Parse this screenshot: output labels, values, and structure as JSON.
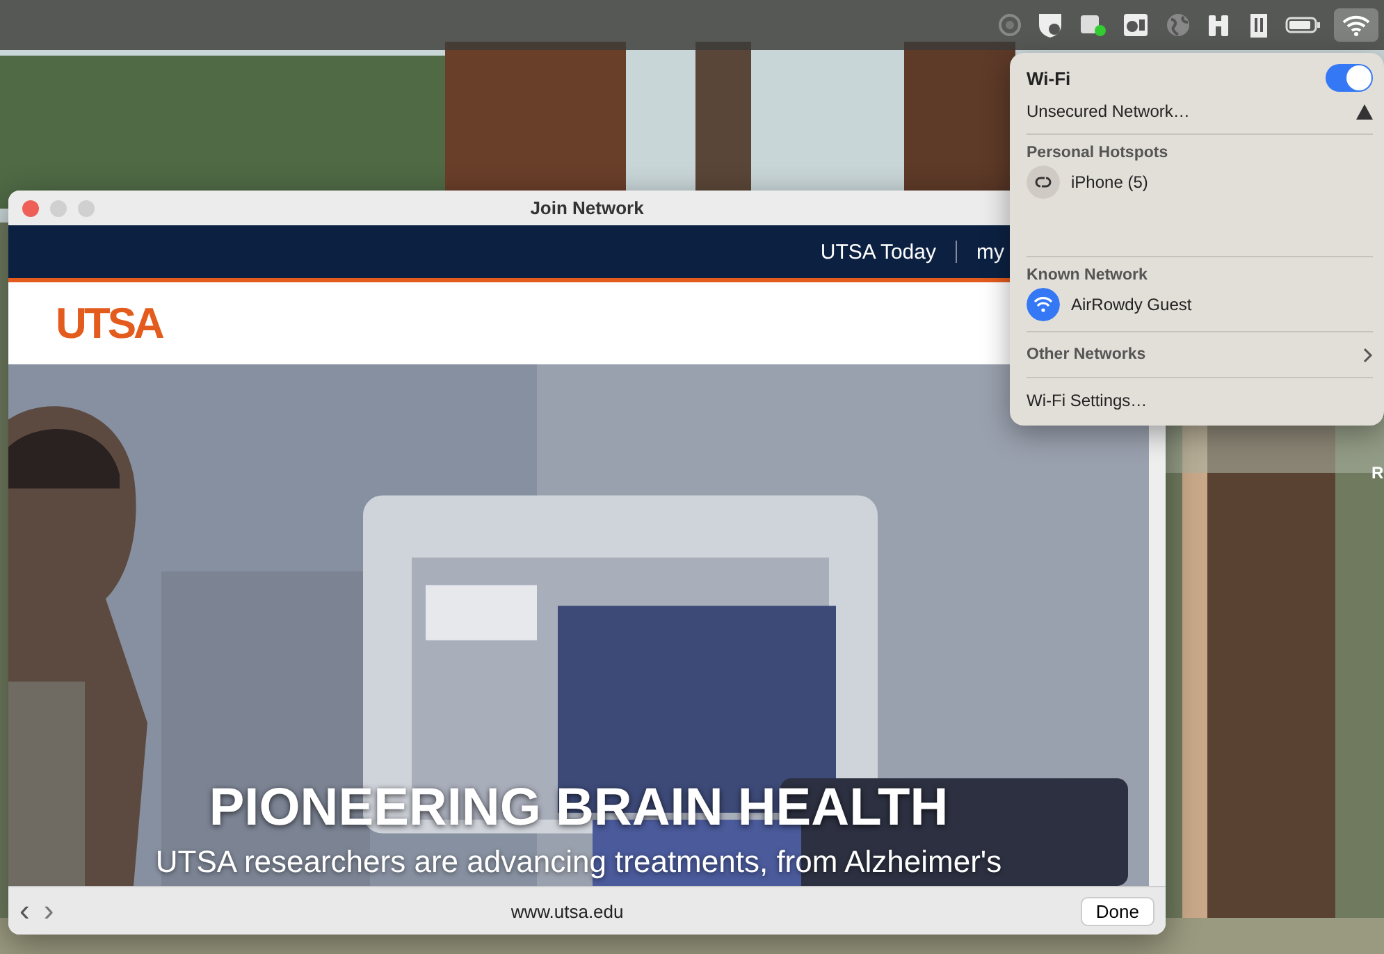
{
  "desktop": {
    "edge_label": "R"
  },
  "window": {
    "title": "Join Network",
    "site_nav": [
      "UTSA Today",
      "my"
    ],
    "logo": "UTSA",
    "hero": {
      "headline": "PIONEERING BRAIN HEALTH",
      "subtitle": "UTSA researchers are advancing treatments, from Alzheimer's"
    },
    "toolbar": {
      "back": "‹",
      "forward": "›",
      "url": "www.utsa.edu",
      "done": "Done"
    }
  },
  "wifi_menu": {
    "title": "Wi-Fi",
    "on": true,
    "unsecured": "Unsecured Network…",
    "sections": [
      {
        "heading": "Personal Hotspots",
        "networks": [
          {
            "name": "iPhone (5)",
            "kind": "hotspot"
          }
        ]
      },
      {
        "heading": "Known Network",
        "networks": [
          {
            "name": "AirRowdy Guest",
            "kind": "wifi"
          }
        ]
      }
    ],
    "other": "Other Networks",
    "settings": "Wi-Fi Settings…"
  }
}
